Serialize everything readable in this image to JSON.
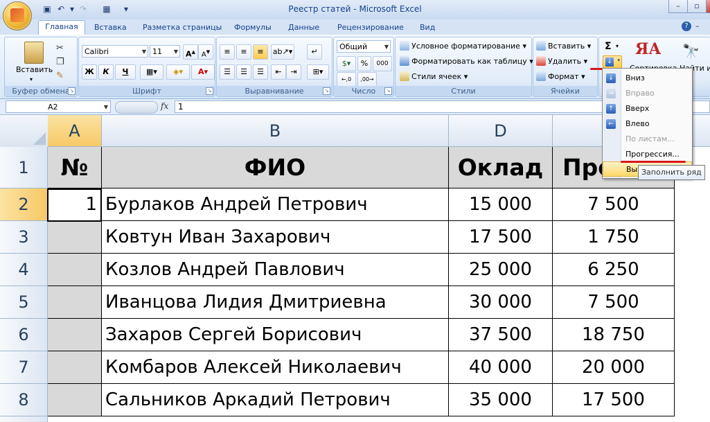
{
  "window": {
    "title": "Реестр статей - Microsoft Excel"
  },
  "tabs": [
    {
      "label": "Главная"
    },
    {
      "label": "Вставка"
    },
    {
      "label": "Разметка страницы"
    },
    {
      "label": "Формулы"
    },
    {
      "label": "Данные"
    },
    {
      "label": "Рецензирование"
    },
    {
      "label": "Вид"
    }
  ],
  "ribbon": {
    "clipboard": {
      "label": "Буфер обмена",
      "paste": "Вставить"
    },
    "font": {
      "label": "Шрифт",
      "name": "Calibri",
      "size": "11",
      "bold": "Ж",
      "italic": "К",
      "underline": "Ч"
    },
    "alignment": {
      "label": "Выравнивание"
    },
    "number": {
      "label": "Число",
      "format": "Общий",
      "percent": "%",
      "thousands": "000"
    },
    "styles": {
      "label": "Стили",
      "conditional": "Условное форматирование",
      "as_table": "Форматировать как таблицу",
      "cell_styles": "Стили ячеек"
    },
    "cells": {
      "label": "Ячейки",
      "insert": "Вставить",
      "delete": "Удалить",
      "format": "Формат"
    },
    "editing": {
      "sigma": "Σ",
      "sort_partial": "Сортировка",
      "find_partial": "Найти и"
    }
  },
  "formula_bar": {
    "name_box": "A2",
    "fx": "fx",
    "value": "1"
  },
  "grid": {
    "columns": [
      "A",
      "B",
      "D"
    ],
    "rows": [
      "1",
      "2",
      "3",
      "4",
      "5",
      "6",
      "7",
      "8"
    ],
    "header": {
      "num": "№",
      "fio": "ФИО",
      "salary": "Оклад",
      "bonus_partial": "Пре"
    },
    "data": [
      {
        "num": "1",
        "fio": "Бурлаков Андрей Петрович",
        "salary": "15 000",
        "bonus": "7 500"
      },
      {
        "num": "",
        "fio": "Ковтун Иван Захарович",
        "salary": "17 500",
        "bonus": "1 750"
      },
      {
        "num": "",
        "fio": "Козлов Андрей Павлович",
        "salary": "25 000",
        "bonus": "6 250"
      },
      {
        "num": "",
        "fio": "Иванцова Лидия Дмитриевна",
        "salary": "30 000",
        "bonus": "7 500"
      },
      {
        "num": "",
        "fio": "Захаров Сергей Борисович",
        "salary": "37 500",
        "bonus": "18 750"
      },
      {
        "num": "",
        "fio": "Комбаров Алексей Николаевич",
        "salary": "40 000",
        "bonus": "20 000"
      },
      {
        "num": "",
        "fio": "Сальников Аркадий Петрович",
        "salary": "35 000",
        "bonus": "17 500"
      }
    ]
  },
  "fill_menu": {
    "items": [
      {
        "label": "Вниз",
        "enabled": true
      },
      {
        "label": "Вправо",
        "enabled": false
      },
      {
        "label": "Вверх",
        "enabled": true
      },
      {
        "label": "Влево",
        "enabled": true
      },
      {
        "label": "По листам...",
        "enabled": false
      },
      {
        "label": "Прогрессия...",
        "enabled": true
      },
      {
        "label": "Вы",
        "enabled": true
      }
    ],
    "tooltip": "Заполнить ряд"
  },
  "colors": {
    "accent_red": "#d8171b",
    "selected_header": "#f7c865",
    "header_fill": "#d9d9d9"
  }
}
